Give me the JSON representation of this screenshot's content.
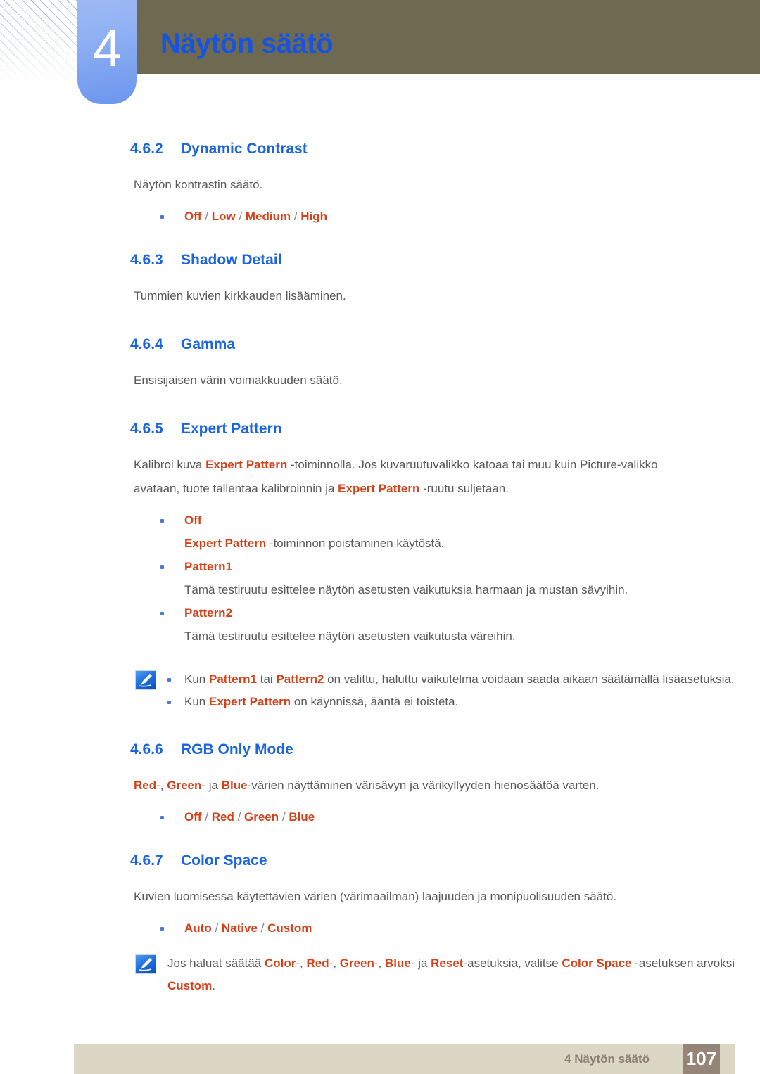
{
  "header": {
    "chapter_number": "4",
    "chapter_title": "Näytön säätö",
    "accent_blue": "#1653e0",
    "olive": "#6e6a52"
  },
  "sections": [
    {
      "num": "4.6.2",
      "title": "Dynamic Contrast",
      "body": "Näytön kontrastin säätö.",
      "options": [
        "Off",
        "Low",
        "Medium",
        "High"
      ]
    },
    {
      "num": "4.6.3",
      "title": "Shadow Detail",
      "body": "Tummien kuvien kirkkauden lisääminen."
    },
    {
      "num": "4.6.4",
      "title": "Gamma",
      "body": "Ensisijaisen värin voimakkuuden säätö."
    },
    {
      "num": "4.6.5",
      "title": "Expert Pattern",
      "body_parts": [
        {
          "t": "Kalibroi kuva ",
          "s": "plain"
        },
        {
          "t": "Expert Pattern",
          "s": "em"
        },
        {
          "t": " -toiminnolla. Jos kuvaruutuvalikko katoaa tai muu kuin Picture-valikko avataan, tuote tallentaa kalibroinnin ja ",
          "s": "plain"
        },
        {
          "t": "Expert Pattern",
          "s": "em"
        },
        {
          "t": " -ruutu suljetaan.",
          "s": "plain"
        }
      ],
      "bullets": [
        {
          "label": "Off",
          "desc_parts": [
            {
              "t": "Expert Pattern",
              "s": "em"
            },
            {
              "t": " -toiminnon poistaminen käytöstä.",
              "s": "plain"
            }
          ]
        },
        {
          "label": "Pattern1",
          "desc_parts": [
            {
              "t": "Tämä testiruutu esittelee näytön asetusten vaikutuksia harmaan ja mustan sävyihin.",
              "s": "plain"
            }
          ]
        },
        {
          "label": "Pattern2",
          "desc_parts": [
            {
              "t": "Tämä testiruutu esittelee näytön asetusten vaikutusta väreihin.",
              "s": "plain"
            }
          ]
        }
      ]
    },
    {
      "num": "4.6.6",
      "title": "RGB Only Mode",
      "body_parts": [
        {
          "t": "Red",
          "s": "em"
        },
        {
          "t": "-, ",
          "s": "plain"
        },
        {
          "t": "Green",
          "s": "em"
        },
        {
          "t": "- ja ",
          "s": "plain"
        },
        {
          "t": "Blue",
          "s": "em"
        },
        {
          "t": "-värien näyttäminen värisävyn ja värikyllyyden hienosäätöä varten.",
          "s": "plain"
        }
      ],
      "options": [
        "Off",
        "Red",
        "Green",
        "Blue"
      ]
    },
    {
      "num": "4.6.7",
      "title": "Color Space",
      "body": "Kuvien luomisessa käytettävien värien (värimaailman) laajuuden ja monipuolisuuden säätö.",
      "options": [
        "Auto",
        "Native",
        "Custom"
      ]
    }
  ],
  "note_expert": {
    "icon": "note-pen-icon",
    "items": [
      [
        {
          "t": "Kun ",
          "s": "plain"
        },
        {
          "t": "Pattern1",
          "s": "em"
        },
        {
          "t": " tai ",
          "s": "plain"
        },
        {
          "t": "Pattern2",
          "s": "em"
        },
        {
          "t": " on valittu, haluttu vaikutelma voidaan saada aikaan säätämällä lisäasetuksia.",
          "s": "plain"
        }
      ],
      [
        {
          "t": "Kun ",
          "s": "plain"
        },
        {
          "t": "Expert Pattern",
          "s": "em"
        },
        {
          "t": " on käynnissä, ääntä ei toisteta.",
          "s": "plain"
        }
      ]
    ]
  },
  "note_colorspace": {
    "icon": "note-pen-icon",
    "text_parts": [
      {
        "t": "Jos haluat säätää ",
        "s": "plain"
      },
      {
        "t": "Color",
        "s": "em"
      },
      {
        "t": "-, ",
        "s": "plain"
      },
      {
        "t": "Red",
        "s": "em"
      },
      {
        "t": "-, ",
        "s": "plain"
      },
      {
        "t": "Green",
        "s": "em"
      },
      {
        "t": "-, ",
        "s": "plain"
      },
      {
        "t": "Blue",
        "s": "em"
      },
      {
        "t": "- ja ",
        "s": "plain"
      },
      {
        "t": "Reset",
        "s": "em"
      },
      {
        "t": "-asetuksia, valitse ",
        "s": "plain"
      },
      {
        "t": "Color Space",
        "s": "em"
      },
      {
        "t": " -asetuksen arvoksi ",
        "s": "plain"
      },
      {
        "t": "Custom",
        "s": "em"
      },
      {
        "t": ".",
        "s": "plain"
      }
    ]
  },
  "footer": {
    "label": "4 Näytön säätö",
    "page": "107",
    "bar_color": "#dcd6c4",
    "page_box_color": "#958578"
  },
  "colors": {
    "heading_blue": "#1b65e0",
    "option_orange": "#d4421a",
    "body_gray": "#58585a",
    "bullet_blue": "#4a78d8"
  }
}
